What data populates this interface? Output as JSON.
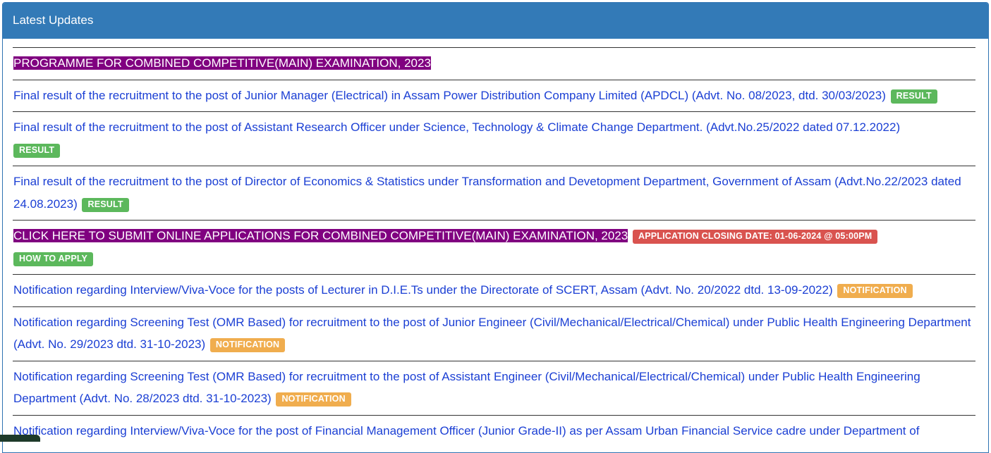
{
  "panel": {
    "title": "Latest Updates"
  },
  "colors": {
    "heading_bg": "#337ab7",
    "link": "#1b3fd4",
    "highlight_bg": "#800080",
    "badge_result": "#5cb85c",
    "badge_notification": "#f0ad4e",
    "badge_closing": "#d9534f"
  },
  "items": [
    {
      "text": "PROGRAMME FOR COMBINED COMPETITIVE(MAIN) EXAMINATION, 2023",
      "highlight": true
    },
    {
      "text": "Final result of the recruitment to the post of Junior Manager (Electrical) in Assam Power Distribution Company Limited (APDCL) (Advt. No. 08/2023, dtd. 30/03/2023)",
      "badge": "RESULT"
    },
    {
      "text": "Final result of the recruitment to the post of Assistant Research Officer under Science, Technology & Climate Change Department. (Advt.No.25/2022 dated 07.12.2022)",
      "badge": "RESULT"
    },
    {
      "text": "Final result of the recruitment to the post of Director of Economics & Statistics under Transformation and Devetopment Department, Government of Assam (Advt.No.22/2023 dated 24.08.2023)",
      "badge": "RESULT"
    },
    {
      "text": "CLICK HERE TO SUBMIT ONLINE APPLICATIONS FOR COMBINED COMPETITIVE(MAIN) EXAMINATION, 2023",
      "highlight": true,
      "badge": "APPLICATION CLOSING DATE: 01-06-2024 @ 05:00PM",
      "badge2": "HOW TO APPLY"
    },
    {
      "text": "Notification regarding Interview/Viva-Voce for the posts of Lecturer in D.I.E.Ts under the Directorate of SCERT, Assam (Advt. No. 20/2022 dtd. 13-09-2022)",
      "badge": "NOTIFICATION"
    },
    {
      "text": "Notification regarding Screening Test (OMR Based) for recruitment to the post of Junior Engineer (Civil/Mechanical/Electrical/Chemical) under Public Health Engineering Department (Advt. No. 29/2023 dtd. 31-10-2023)",
      "badge": "NOTIFICATION"
    },
    {
      "text": "Notification regarding Screening Test (OMR Based) for recruitment to the post of Assistant Engineer (Civil/Mechanical/Electrical/Chemical) under Public Health Engineering Department (Advt. No. 28/2023 dtd. 31-10-2023)",
      "badge": "NOTIFICATION"
    },
    {
      "text": "Notification regarding Interview/Viva-Voce for the post of Financial Management Officer (Junior Grade-II) as per Assam Urban Financial Service cadre under Department of"
    }
  ]
}
